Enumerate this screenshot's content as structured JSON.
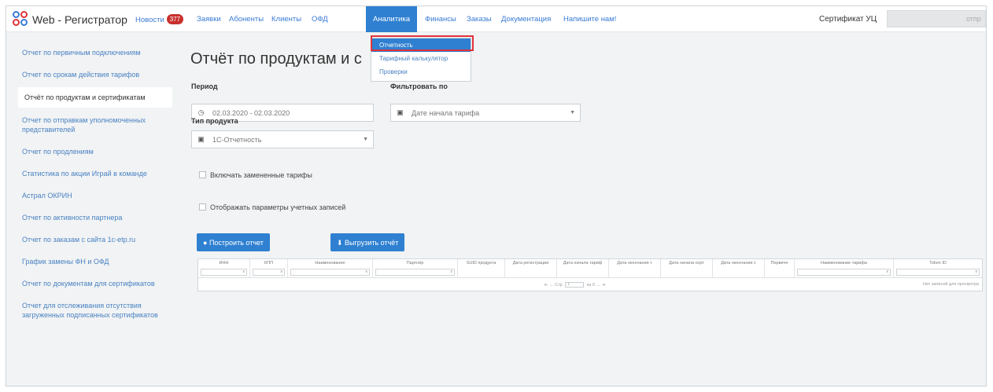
{
  "topnav": {
    "brand": "Web - Регистратор",
    "items": [
      {
        "label": "Новости",
        "badge": "377"
      },
      {
        "label": "Заявки"
      },
      {
        "label": "Абоненты"
      },
      {
        "label": "Клиенты"
      },
      {
        "label": "ОФД"
      },
      {
        "label": "Аналитика",
        "active": true
      },
      {
        "label": "Финансы"
      },
      {
        "label": "Заказы"
      },
      {
        "label": "Документация"
      },
      {
        "label": "Напишите нам!"
      }
    ],
    "certificate_label": "Сертификат УЦ",
    "certificate_value": "отпр"
  },
  "dropdown": {
    "items": [
      "Отчетность",
      "Тарифный калькулятор",
      "Проверки"
    ]
  },
  "sidebar": {
    "items": [
      {
        "label": "Отчет по первичным подключениям"
      },
      {
        "label": "Отчет по срокам действия тарифов"
      },
      {
        "label": "Отчёт по продуктам и сертификатам",
        "active": true
      },
      {
        "label": "Отчет по отправкам уполномоченных представителей"
      },
      {
        "label": "Отчет по продлениям"
      },
      {
        "label": "Статистика по акции Играй в команде"
      },
      {
        "label": "Астрал ОКРИН"
      },
      {
        "label": "Отчет по активности партнера"
      },
      {
        "label": "Отчет по заказам с сайта 1c-etp.ru"
      },
      {
        "label": "График замены ФН и ОФД"
      },
      {
        "label": "Отчет по документам для сертификатов"
      },
      {
        "label": "Отчет для отслеживания отсутствия загруженных подписанных сертификатов"
      }
    ]
  },
  "main": {
    "title": "Отчёт по продуктам и с",
    "period_label": "Период",
    "period_value": "02.03.2020 - 02.03.2020",
    "filter_label": "Фильтровать по",
    "filter_value": "Дате начала тарифа",
    "product_type_label": "Тип продукта",
    "product_type_value": "1С-Отчетность",
    "checkbox_replaced": "Включать замененные тарифы",
    "checkbox_params": "Отображать параметры учетных записей",
    "build_button": "Построить отчет",
    "export_button": "Выгрузить отчёт"
  },
  "table": {
    "columns": [
      "ИНН",
      "КПП",
      "Наименование",
      "Партнёр",
      "SUID продукта",
      "Дата регистрации",
      "Дата начала тариф",
      "Дата окончания т",
      "Дата начала серт",
      "Дата окончания с",
      "Первичн",
      "Наименование тарифа",
      "Token ID"
    ],
    "page_label": "Стр",
    "page_value": "1",
    "page_of": "из 0",
    "no_records": "Нет записей для просмотра"
  },
  "colors": {
    "accent": "#2f80d1",
    "badge": "#c9302c",
    "highlight": "#e0323a"
  }
}
